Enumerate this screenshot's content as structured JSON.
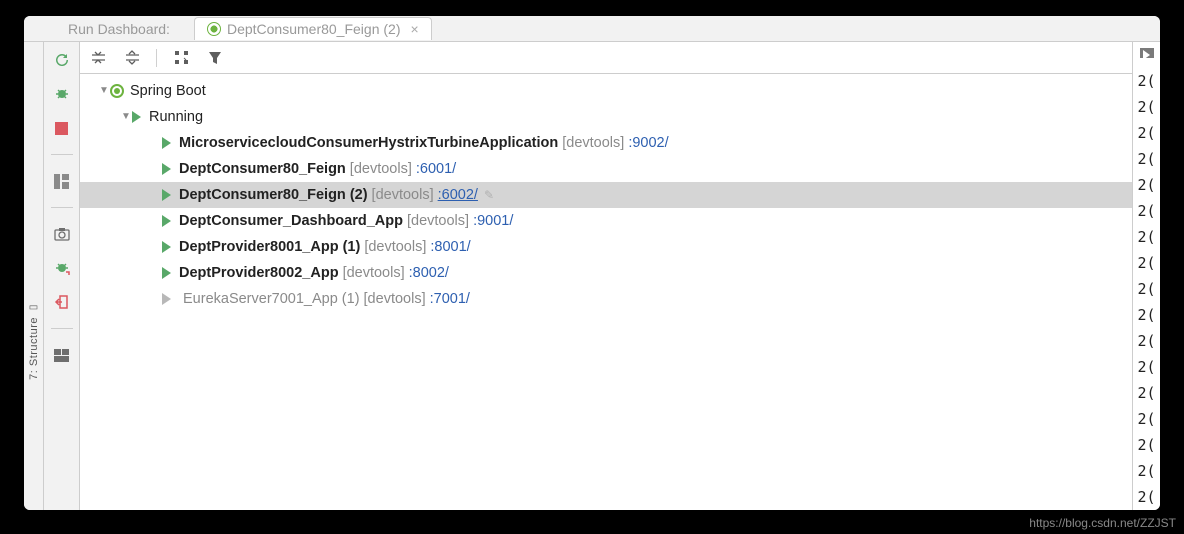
{
  "header": {
    "title": "Run Dashboard:",
    "tab_label": "DeptConsumer80_Feign (2)",
    "tab_close": "×"
  },
  "sidetool": {
    "label": "7: Structure"
  },
  "tree": {
    "root_label": "Spring Boot",
    "running_label": "Running",
    "items": [
      {
        "name": "MicroservicecloudConsumerHystrixTurbineApplication",
        "dev": "[devtools]",
        "port": ":9002/",
        "bold": true,
        "active": true,
        "selected": false
      },
      {
        "name": "DeptConsumer80_Feign",
        "dev": "[devtools]",
        "port": ":6001/",
        "bold": true,
        "active": true,
        "selected": false
      },
      {
        "name": "DeptConsumer80_Feign (2)",
        "dev": "[devtools]",
        "port": ":6002/",
        "bold": true,
        "active": true,
        "selected": true,
        "editable": true
      },
      {
        "name": "DeptConsumer_Dashboard_App",
        "dev": "[devtools]",
        "port": ":9001/",
        "bold": true,
        "active": true,
        "selected": false
      },
      {
        "name": "DeptProvider8001_App (1)",
        "dev": "[devtools]",
        "port": ":8001/",
        "bold": true,
        "active": true,
        "selected": false
      },
      {
        "name": "DeptProvider8002_App",
        "dev": "[devtools]",
        "port": ":8002/",
        "bold": true,
        "active": true,
        "selected": false
      },
      {
        "name": "EurekaServer7001_App (1)",
        "dev": "[devtools]",
        "port": ":7001/",
        "bold": false,
        "active": false,
        "selected": false
      }
    ]
  },
  "rightpanel": {
    "timestamps": [
      "2(",
      "2(",
      "2(",
      "2(",
      "2(",
      "2(",
      "2(",
      "2(",
      "2(",
      "2(",
      "2(",
      "2(",
      "2(",
      "2(",
      "2(",
      "2(",
      "2("
    ]
  },
  "watermark": "https://blog.csdn.net/ZZJST"
}
